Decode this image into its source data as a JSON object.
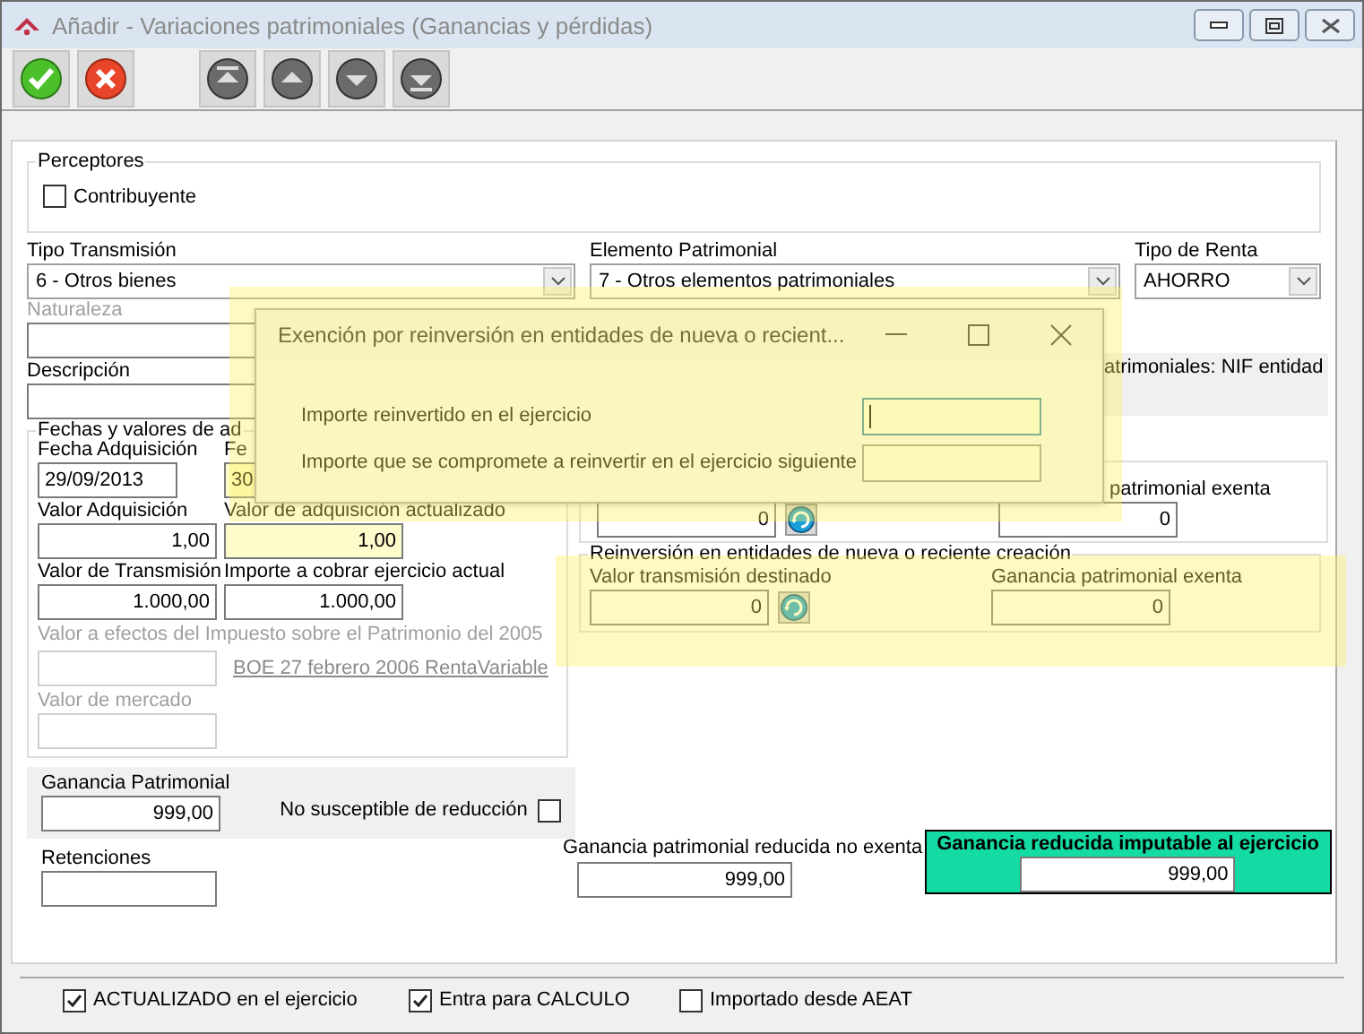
{
  "window": {
    "title": "Añadir  - Variaciones patrimoniales (Ganancias y pérdidas)"
  },
  "toolbar": [
    {
      "kind": "accept"
    },
    {
      "kind": "cancel"
    },
    {
      "kind": "first"
    },
    {
      "kind": "previous"
    },
    {
      "kind": "next"
    },
    {
      "kind": "last"
    }
  ],
  "perceptores": {
    "title": "Perceptores",
    "contribuyente": {
      "label": "Contribuyente",
      "checked": false
    }
  },
  "combos": [
    {
      "label": "Tipo Transmisión",
      "value": "6 - Otros bienes"
    },
    {
      "label": "Elemento Patrimonial",
      "value": "7 - Otros elementos patrimoniales"
    },
    {
      "label": "Tipo de Renta",
      "value": "AHORRO"
    }
  ],
  "naturaleza": {
    "label": "Naturaleza",
    "disabled": true
  },
  "descripcion": {
    "label": "Descripción"
  },
  "nif_note": "atrimoniales: NIF entidad",
  "fechas": {
    "title": "Fechas y valores de ad",
    "rows": [
      [
        {
          "label": "Fecha Adquisición",
          "value": "29/09/2013",
          "highlighted": false
        },
        {
          "label": "Fe",
          "value": "30",
          "highlighted": true
        }
      ],
      [
        {
          "label": "Valor Adquisición",
          "value": "1,00",
          "highlighted": false
        },
        {
          "label": "Valor de adquisición actualizado",
          "value": "1,00",
          "highlighted": true
        }
      ],
      [
        {
          "label": "Valor de Transmisión",
          "value": "1.000,00",
          "highlighted": false
        },
        {
          "label": "Importe a cobrar ejercicio actual",
          "value": "1.000,00",
          "highlighted": false
        }
      ]
    ],
    "patrimonio_2005": {
      "label": "Valor a efectos del Impuesto sobre el Patrimonio del 2005",
      "disabled": true
    },
    "boe_link": "BOE 27 febrero 2006 RentaVariable",
    "valor_mercado": {
      "label": "Valor de mercado",
      "disabled": true
    }
  },
  "exencion": {
    "fields": [
      {
        "value": "0"
      },
      {
        "label": "patrimonial exenta",
        "value": "0"
      }
    ]
  },
  "reinversion": {
    "title": "Reinversión en entidades de nueva o reciente creación",
    "fields": [
      {
        "label": "Valor transmisión destinado",
        "value": "0"
      },
      {
        "label": "Ganancia patrimonial exenta",
        "value": "0"
      }
    ]
  },
  "ganancia_patrimonial": {
    "label": "Ganancia Patrimonial",
    "value": "999,00"
  },
  "no_susceptible": {
    "label": "No susceptible de reducción",
    "checked": false
  },
  "retenciones": {
    "label": "Retenciones"
  },
  "reducida_no_exenta": {
    "label": "Ganancia patrimonial reducida no exenta",
    "value": "999,00"
  },
  "imputable": {
    "label": "Ganancia reducida imputable al ejercicio",
    "value": "999,00"
  },
  "footer": [
    {
      "label": "ACTUALIZADO en el ejercicio",
      "checked": true
    },
    {
      "label": "Entra para CALCULO",
      "checked": true
    },
    {
      "label": "Importado desde AEAT",
      "checked": false
    }
  ],
  "dialog": {
    "title": "Exención por reinversión en entidades de nueva o recient...",
    "fields": [
      {
        "label": "Importe reinvertido en el ejercicio",
        "focused": true
      },
      {
        "label": "Importe que se compromete a reinvertir en el ejercicio siguiente",
        "focused": false
      }
    ]
  }
}
